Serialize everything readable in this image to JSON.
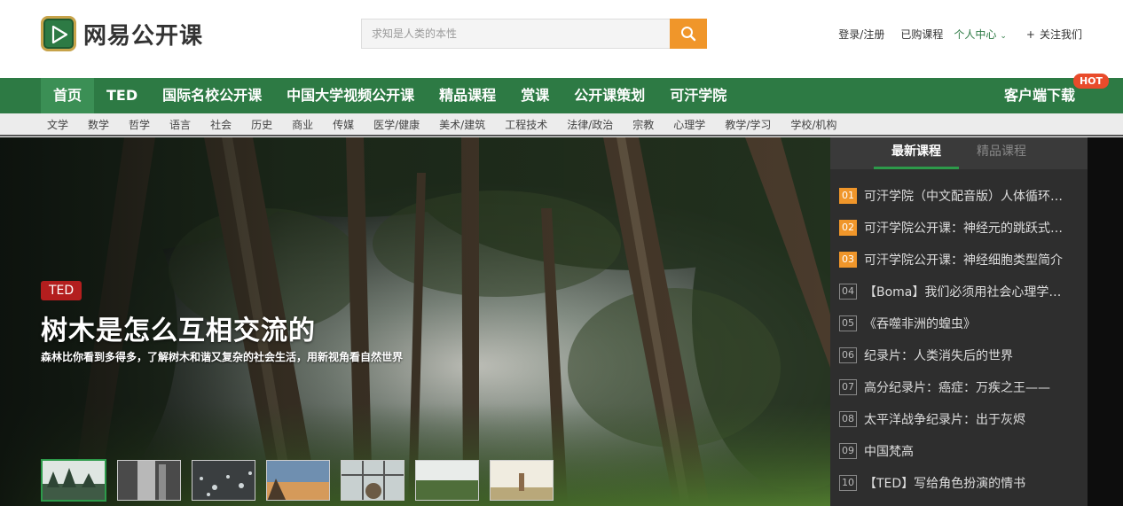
{
  "header": {
    "logo_text": "网易公开课",
    "search_placeholder": "求知是人类的本性",
    "links": {
      "login": "登录/注册",
      "bought": "已购课程",
      "user_center": "个人中心",
      "follow": "关注我们"
    }
  },
  "mainnav": {
    "items": [
      "首页",
      "TED",
      "国际名校公开课",
      "中国大学视频公开课",
      "精品课程",
      "赏课",
      "公开课策划",
      "可汗学院"
    ],
    "client_download": "客户端下载",
    "hot_badge": "HOT"
  },
  "subnav": {
    "items": [
      "文学",
      "数学",
      "哲学",
      "语言",
      "社会",
      "历史",
      "商业",
      "传媒",
      "医学/健康",
      "美术/建筑",
      "工程技术",
      "法律/政治",
      "宗教",
      "心理学",
      "教学/学习",
      "学校/机构"
    ]
  },
  "hero": {
    "tag": "TED",
    "title": "树木是怎么互相交流的",
    "subtitle": "森林比你看到多得多，了解树木和谐又复杂的社会生活，用新视角看自然世界"
  },
  "side": {
    "tabs": [
      "最新课程",
      "精品课程"
    ],
    "items": [
      {
        "num": "01",
        "title": "可汗学院（中文配音版）人体循环系统"
      },
      {
        "num": "02",
        "title": "可汗学院公开课：神经元的跳跃式传导"
      },
      {
        "num": "03",
        "title": "可汗学院公开课：神经细胞类型简介"
      },
      {
        "num": "04",
        "title": "【Boma】我们必须用社会心理学来解决"
      },
      {
        "num": "05",
        "title": "《吞噬非洲的蝗虫》"
      },
      {
        "num": "06",
        "title": "纪录片：人类消失后的世界"
      },
      {
        "num": "07",
        "title": "高分纪录片：癌症：万疾之王——"
      },
      {
        "num": "08",
        "title": "太平洋战争纪录片：出于灰烬"
      },
      {
        "num": "09",
        "title": "中国梵高"
      },
      {
        "num": "10",
        "title": "【TED】写给角色扮演的情书"
      }
    ]
  }
}
